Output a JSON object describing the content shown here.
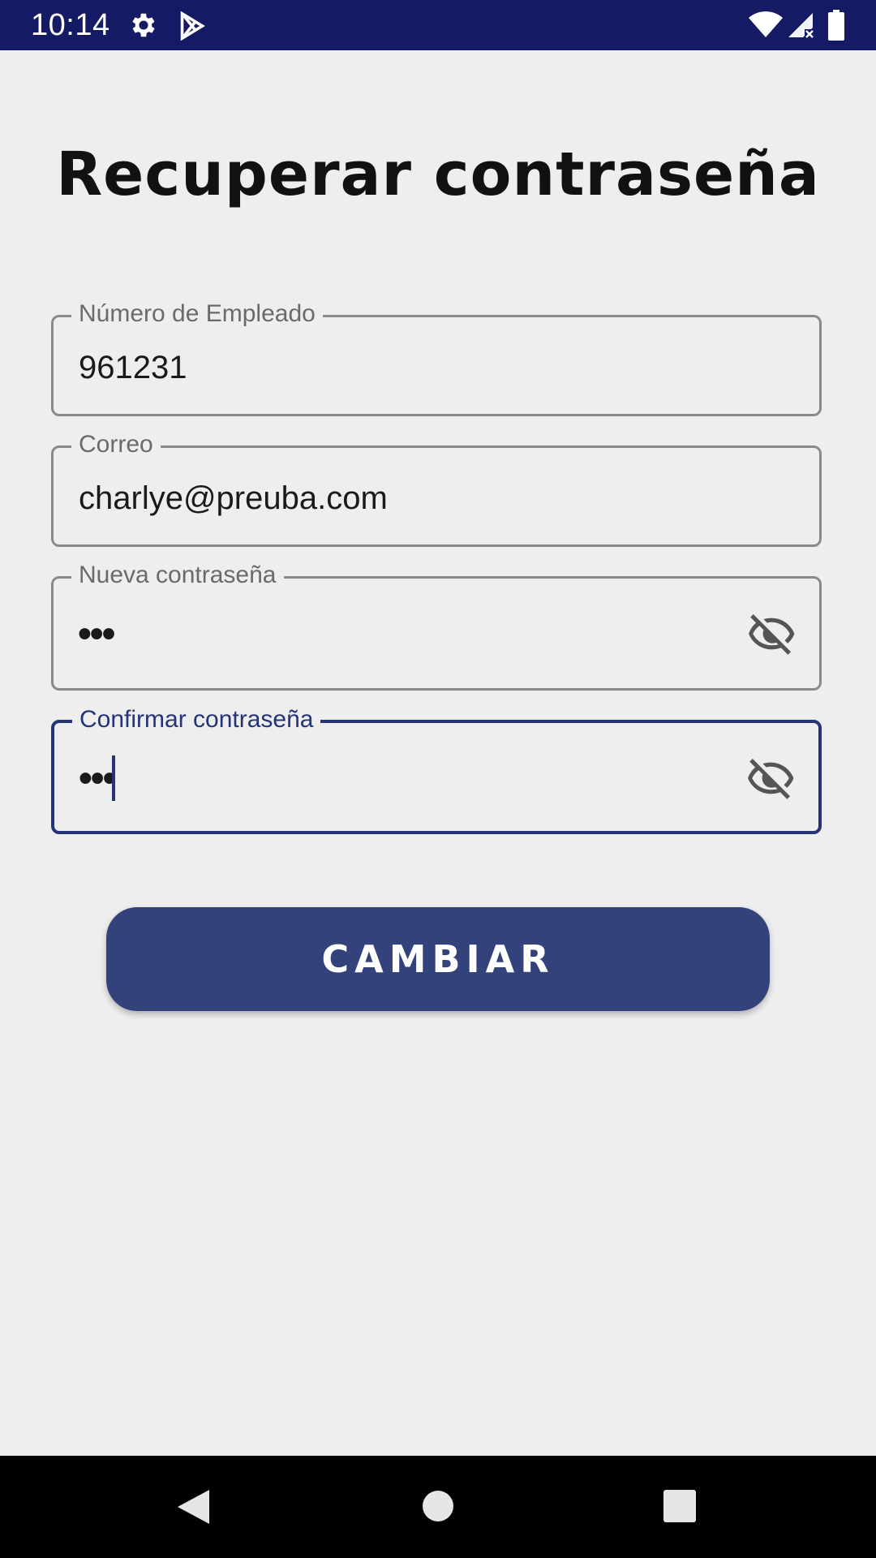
{
  "status_bar": {
    "time": "10:14",
    "icons": [
      "settings-icon",
      "play-store-icon",
      "wifi-icon",
      "signal-icon",
      "battery-icon"
    ],
    "background": "#141a64"
  },
  "title": "Recuperar contraseña",
  "form": {
    "employee_number": {
      "label": "Número de Empleado",
      "value": "961231"
    },
    "email": {
      "label": "Correo",
      "value": "charlye@preuba.com"
    },
    "new_password": {
      "label": "Nueva contraseña",
      "value": "•••",
      "toggle_icon": "visibility-off-icon"
    },
    "confirm_password": {
      "label": "Confirmar contraseña",
      "value": "•••",
      "toggle_icon": "visibility-off-icon",
      "focused": true
    }
  },
  "submit_button": {
    "label": "CAMBIAR",
    "color": "#33427b"
  },
  "nav_bar": {
    "buttons": [
      "back-icon",
      "home-icon",
      "recents-icon"
    ]
  },
  "colors": {
    "accent": "#253377",
    "background": "#eeeeef"
  }
}
